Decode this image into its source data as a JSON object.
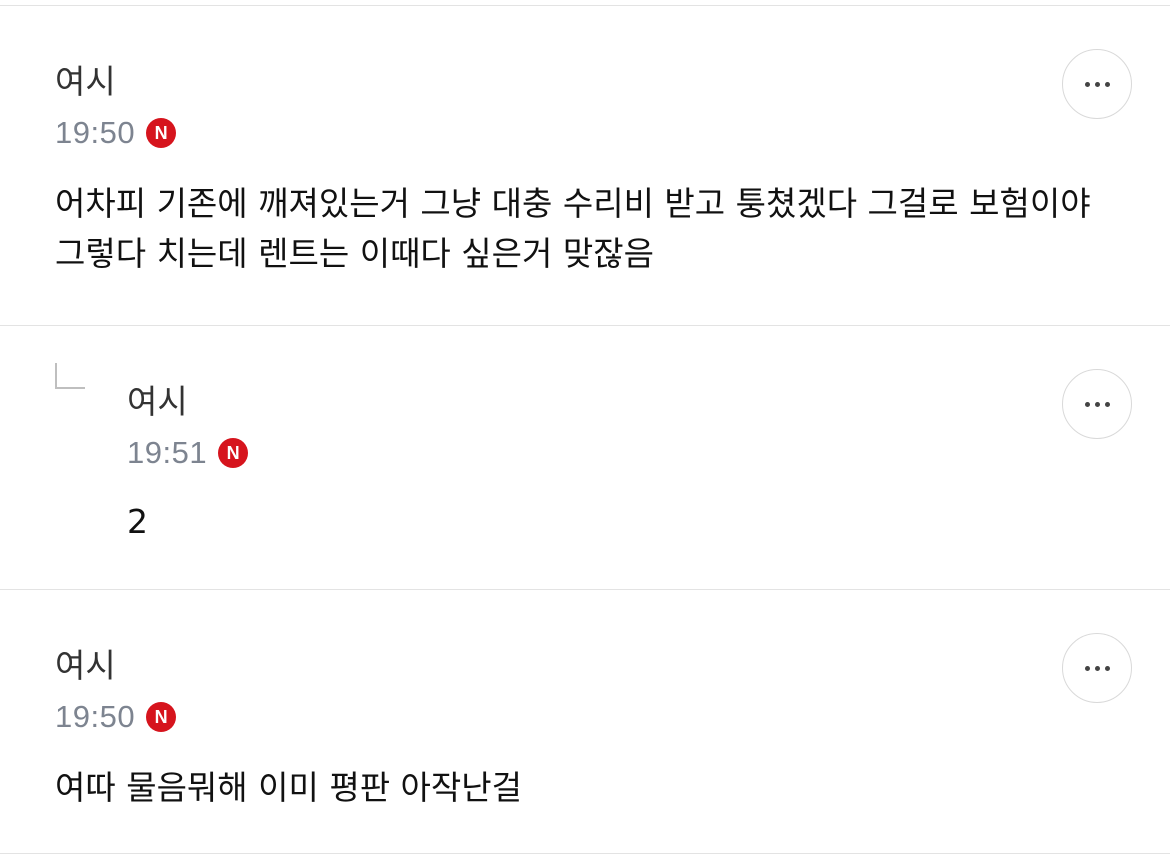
{
  "comments": [
    {
      "author": "여시",
      "time": "19:50",
      "badge": "N",
      "text": "어차피 기존에 깨져있는거 그냥 대충 수리비 받고 퉁쳤겠다 그걸로 보험이야 그렇다 치는데 렌트는 이때다 싶은거 맞잖음",
      "is_reply": false
    },
    {
      "author": "여시",
      "time": "19:51",
      "badge": "N",
      "text": "2",
      "is_reply": true
    },
    {
      "author": "여시",
      "time": "19:50",
      "badge": "N",
      "text": "여따 물음뭐해 이미 평판 아작난걸",
      "is_reply": false
    }
  ],
  "icons": {
    "more": "more-horizontal-icon",
    "reply": "reply-arrow-icon"
  },
  "colors": {
    "badge": "#d6141d",
    "time": "#7d8490",
    "divider": "#e3e3e3"
  }
}
